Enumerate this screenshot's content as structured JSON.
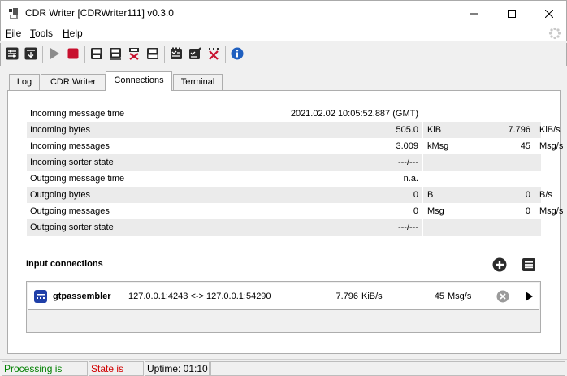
{
  "window": {
    "title": "CDR Writer [CDRWriter111] v0.3.0",
    "icon": "cdr-app-icon"
  },
  "menu": {
    "items": [
      {
        "first": "F",
        "rest": "ile"
      },
      {
        "first": "T",
        "rest": "ools"
      },
      {
        "first": "H",
        "rest": "elp"
      }
    ]
  },
  "toolbar": {
    "icons": [
      "settings-sliders-icon",
      "download-config-icon",
      "play-icon",
      "stop-icon",
      "save-icon",
      "save-as-icon",
      "delete-save-icon",
      "eject-icon",
      "checklist-icon",
      "checklist-edit-icon",
      "checklist-delete-icon",
      "info-icon"
    ]
  },
  "tabs": [
    {
      "label": "Log"
    },
    {
      "label": "CDR Writer"
    },
    {
      "label": "Connections"
    },
    {
      "label": "Terminal"
    }
  ],
  "stats": [
    {
      "label": "Incoming message time",
      "v1": "2021.02.02 10:05:52.887 (GMT)",
      "u1": "",
      "v2": "",
      "u2": ""
    },
    {
      "label": "Incoming bytes",
      "v1": "505.0",
      "u1": "KiB",
      "v2": "7.796",
      "u2": "KiB/s"
    },
    {
      "label": "Incoming messages",
      "v1": "3.009",
      "u1": "kMsg",
      "v2": "45",
      "u2": "Msg/s"
    },
    {
      "label": "Incoming sorter state",
      "v1": "---/---",
      "u1": "",
      "v2": "",
      "u2": ""
    },
    {
      "label": "Outgoing message time",
      "v1": "n.a.",
      "u1": "",
      "v2": "",
      "u2": ""
    },
    {
      "label": "Outgoing bytes",
      "v1": "0",
      "u1": "B",
      "v2": "0",
      "u2": "B/s"
    },
    {
      "label": "Outgoing messages",
      "v1": "0",
      "u1": "Msg",
      "v2": "0",
      "u2": "Msg/s"
    },
    {
      "label": "Outgoing sorter state",
      "v1": "---/---",
      "u1": "",
      "v2": "",
      "u2": ""
    }
  ],
  "input_connections": {
    "title": "Input connections",
    "items": [
      {
        "name": "gtpassembler",
        "address": "127.0.0.1:4243 <-> 127.0.0.1:54290",
        "rate": "7.796",
        "rate_unit": "KiB/s",
        "msgs": "45",
        "msgs_unit": "Msg/s"
      }
    ]
  },
  "status": {
    "processing": "Processing is active",
    "state": "State is dirty",
    "uptime": "Uptime: 01:10",
    "colors": {
      "processing": "#008000",
      "state": "#d00000"
    }
  }
}
